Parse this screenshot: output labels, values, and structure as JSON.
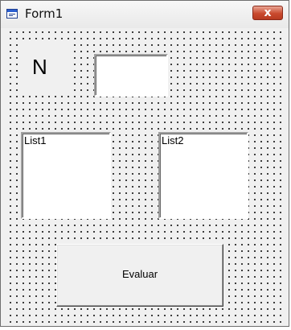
{
  "window": {
    "title": "Form1",
    "close_label": "x"
  },
  "form": {
    "label_n": "N",
    "textbox_value": "",
    "list1": {
      "items": [
        "List1"
      ]
    },
    "list2": {
      "items": [
        "List2"
      ]
    },
    "evaluate_button": "Evaluar"
  },
  "icons": {
    "app": "form-window-icon",
    "close": "close-icon"
  },
  "colors": {
    "close_button": "#c94a2e",
    "form_background": "#f0f0f0"
  }
}
